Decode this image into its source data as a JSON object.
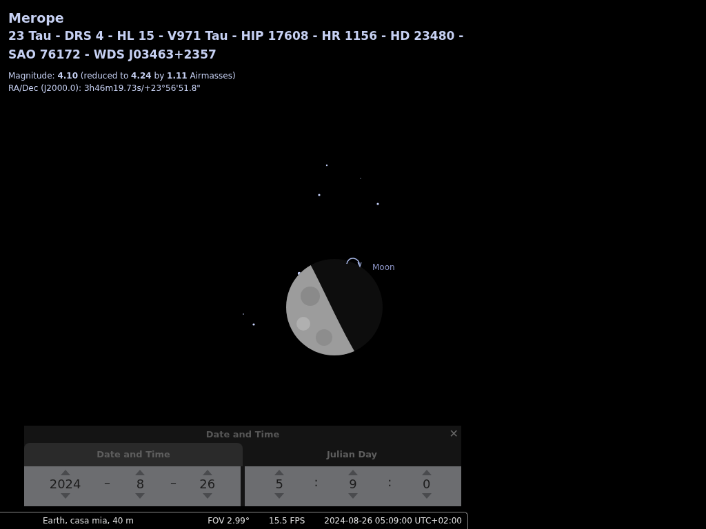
{
  "object_info": {
    "name": "Merope",
    "designations": "23 Tau - DRS 4 - HL 15 - V971 Tau - HIP 17608 - HR 1156 - HD 23480 -",
    "designations_cont": "SAO 76172 - WDS J03463+2357",
    "magnitude": "Magnitude: **4.10** (reduced to **4.24** by **1.11** Airmasses)",
    "radec": "RA/Dec (J2000.0): 3h46m19.73s/+23°56'51.8\""
  },
  "sky": {
    "moon_label": "Moon"
  },
  "dialog": {
    "title": "Date and Time",
    "close": "✕",
    "tabs": [
      {
        "label": "Date and Time",
        "selected": true
      },
      {
        "label": "Julian Day",
        "selected": false
      }
    ],
    "date_fields": [
      {
        "kind": "spinner",
        "value": "2024"
      },
      {
        "kind": "separator",
        "value": "–"
      },
      {
        "kind": "spinner",
        "value": "8"
      },
      {
        "kind": "separator",
        "value": "–"
      },
      {
        "kind": "spinner",
        "value": "26"
      }
    ],
    "time_fields": [
      {
        "kind": "spinner",
        "value": "5"
      },
      {
        "kind": "separator",
        "value": ":"
      },
      {
        "kind": "spinner",
        "value": "9"
      },
      {
        "kind": "separator",
        "value": ":"
      },
      {
        "kind": "spinner",
        "value": "0"
      }
    ]
  },
  "status_bar": {
    "location": "Earth, casa mia, 40 m",
    "fov": "FOV 2.99°",
    "fps": "15.5 FPS",
    "datetime": "2024-08-26 05:09:00 UTC+02:00"
  }
}
